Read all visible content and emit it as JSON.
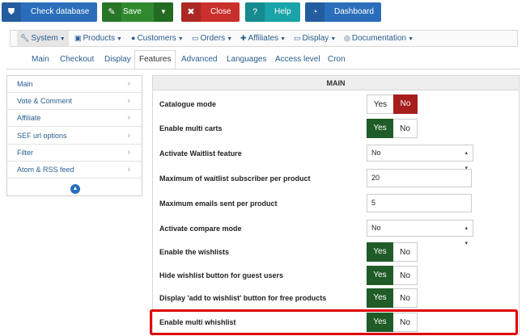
{
  "toolbar": {
    "check_database": "Check database",
    "save": "Save",
    "close": "Close",
    "help": "Help",
    "dashboard": "Dashboard"
  },
  "menu": {
    "items": [
      "System",
      "Products",
      "Customers",
      "Orders",
      "Affiliates",
      "Display",
      "Documentation"
    ]
  },
  "tabs": {
    "items": [
      "Main",
      "Checkout",
      "Display",
      "Features",
      "Advanced",
      "Languages",
      "Access level",
      "Cron"
    ],
    "active": "Features"
  },
  "sidebar": {
    "items": [
      "Main",
      "Vote & Comment",
      "Affiliate",
      "SEF url options",
      "Filter",
      "Atom & RSS feed"
    ]
  },
  "panel": {
    "title": "MAIN",
    "rows": [
      {
        "label": "Catalogue mode",
        "type": "toggle",
        "value": "No"
      },
      {
        "label": "Enable multi carts",
        "type": "toggle",
        "value": "Yes"
      },
      {
        "label": "Activate Waitlist feature",
        "type": "select",
        "value": "No"
      },
      {
        "label": "Maximum of waitlist subscriber per product",
        "type": "input",
        "value": "20"
      },
      {
        "label": "Maximum emails sent per product",
        "type": "input",
        "value": "5"
      },
      {
        "label": "Activate compare mode",
        "type": "select",
        "value": "No"
      },
      {
        "label": "Enable the wishlists",
        "type": "toggle",
        "value": "Yes"
      },
      {
        "label": "Hide wishlist button for guest users",
        "type": "toggle",
        "value": "Yes"
      },
      {
        "label": "Display 'add to wishlist' button for free products",
        "type": "toggle",
        "value": "Yes"
      },
      {
        "label": "Enable multi whishlist",
        "type": "toggle",
        "value": "Yes"
      }
    ],
    "yes_label": "Yes",
    "no_label": "No"
  },
  "colors": {
    "primary": "#2a6ebb",
    "success": "#2f8a2f",
    "danger": "#c9302c",
    "info": "#1aa3a8",
    "toggle_yes": "#1f5c27",
    "toggle_no": "#a61d1d",
    "highlight": "#e00000"
  }
}
